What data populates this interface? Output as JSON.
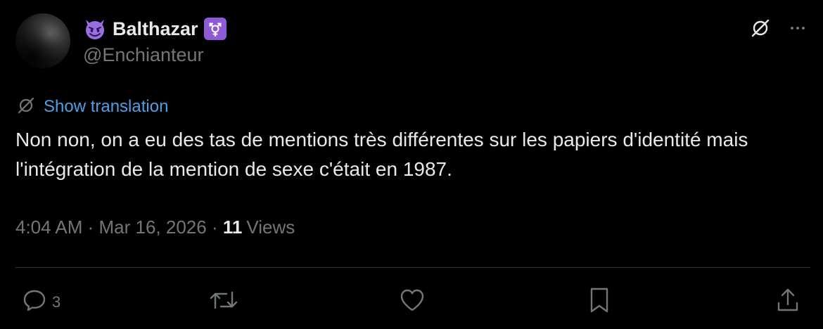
{
  "author": {
    "display_name": "Balthazar",
    "handle": "@Enchianteur",
    "emoji_icon": "smiling-imp-icon",
    "badge_icon": "transgender-symbol-icon",
    "badge_color": "#8f5ad6"
  },
  "translation": {
    "link_label": "Show translation",
    "link_color": "#4f9fe6"
  },
  "tweet": {
    "text": "Non non, on a eu des tas de mentions très différentes sur les papiers d'identité mais l'intégration de la mention de sexe c'était en 1987."
  },
  "meta": {
    "time": "4:04 AM",
    "separator_1": " · ",
    "date": "Mar 16, 2026",
    "separator_2": " · ",
    "views_count": "11",
    "views_label": "Views"
  },
  "actions": {
    "reply_count": "3"
  },
  "colors": {
    "background": "#000000",
    "text_primary": "#e7e9ea",
    "text_secondary": "#71767b",
    "divider": "#2f3336"
  }
}
